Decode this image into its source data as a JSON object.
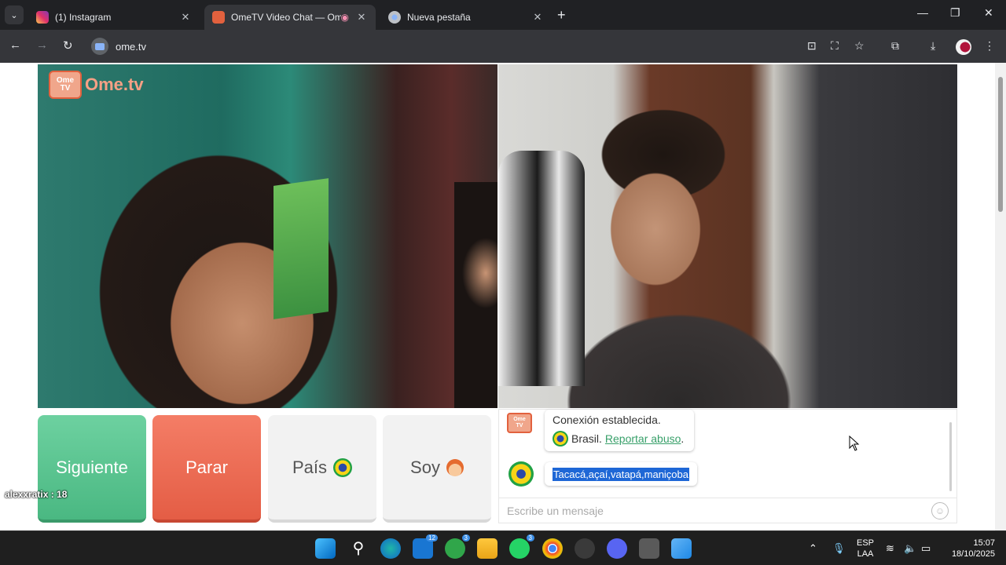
{
  "browser": {
    "tabs": [
      {
        "title": "(1) Instagram",
        "active": false
      },
      {
        "title": "OmeTV Video Chat — Ome",
        "active": true
      },
      {
        "title": "Nueva pestaña",
        "active": false
      }
    ],
    "url": "ome.tv"
  },
  "page": {
    "logo_text": "Ome.tv",
    "logo_badge_top": "Ome",
    "logo_badge_bottom": "TV",
    "buttons": {
      "next": "Siguiente",
      "stop": "Parar",
      "country": "País",
      "me": "Soy"
    },
    "overlay_user": "alexxratix : 18",
    "chat": {
      "system_line1": "Conexión establecida.",
      "system_country": "Brasil.",
      "report_link": "Reportar abuso",
      "message": "Tacacá,açaí,vatapá,maniçoba",
      "input_placeholder": "Escribe un mensaje"
    }
  },
  "taskbar": {
    "badges": {
      "outlook": "12",
      "xbox": "3",
      "whatsapp": "3"
    },
    "lang_top": "ESP",
    "lang_bottom": "LAA",
    "time": "15:07",
    "date": "18/10/2025"
  },
  "colors": {
    "next": "#4ab882",
    "stop": "#e45d45",
    "link": "#38a06a",
    "selection": "#1e67d6"
  }
}
